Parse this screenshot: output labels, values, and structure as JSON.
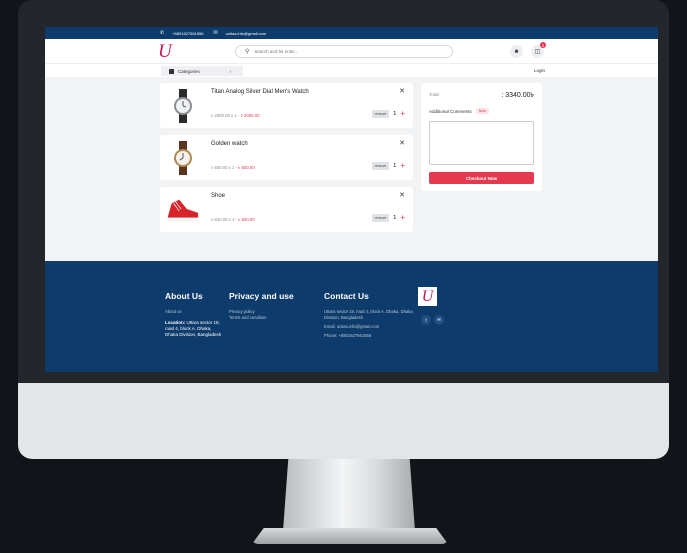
{
  "topbar": {
    "phone": "+8801627561556",
    "email": "unitas.info@gmail.com"
  },
  "header": {
    "logo": "U",
    "search_placeholder": "Search and hit enter...",
    "cart_count": "0"
  },
  "nav": {
    "categories": "Categories",
    "login": "Login"
  },
  "cart": {
    "items": [
      {
        "name": "Titan Analog Silver Dial Men's Watch",
        "price": "৳ 2000.00 x 1",
        "total": "৳ 2000.00",
        "qty": "1",
        "remove": "remove",
        "image": "watch-silver"
      },
      {
        "name": "Golden watch",
        "price": "৳ 500.00 x 1",
        "total": "৳ 500.00",
        "qty": "1",
        "remove": "remove",
        "image": "watch-golden"
      },
      {
        "name": "Shoe",
        "price": "৳ 840.00 x 1",
        "total": "৳ 840.00",
        "qty": "1",
        "remove": "remove",
        "image": "shoe-red"
      }
    ]
  },
  "summary": {
    "total_label": "Total:",
    "total_value": ": 3340.00৳",
    "comments_label": "Additional Comments",
    "note_badge": "Note",
    "checkout": "Checkout Now"
  },
  "footer": {
    "about": {
      "title": "About Us",
      "link": "About us",
      "location_label": "Location:",
      "location": "Uttara sector 18, road 4, block A. Dhaka, Dhaka Division, Bangladesh"
    },
    "privacy": {
      "title": "Privacy and use",
      "links": [
        "Privacy policy",
        "Terms and condition"
      ]
    },
    "contact": {
      "title": "Contact Us",
      "address": "Uttara sector 18, road 4, block A. Dhaka, Dhaka Division, Bangladesh",
      "email": "Email: unitas.info@gmail.com",
      "phone": "Phone: +8801627561556"
    },
    "logo": "U",
    "social": [
      "f",
      "✉"
    ]
  },
  "colors": {
    "brand_navy": "#0d3b6b",
    "accent_red": "#e53950",
    "logo_pink": "#c2185b"
  }
}
